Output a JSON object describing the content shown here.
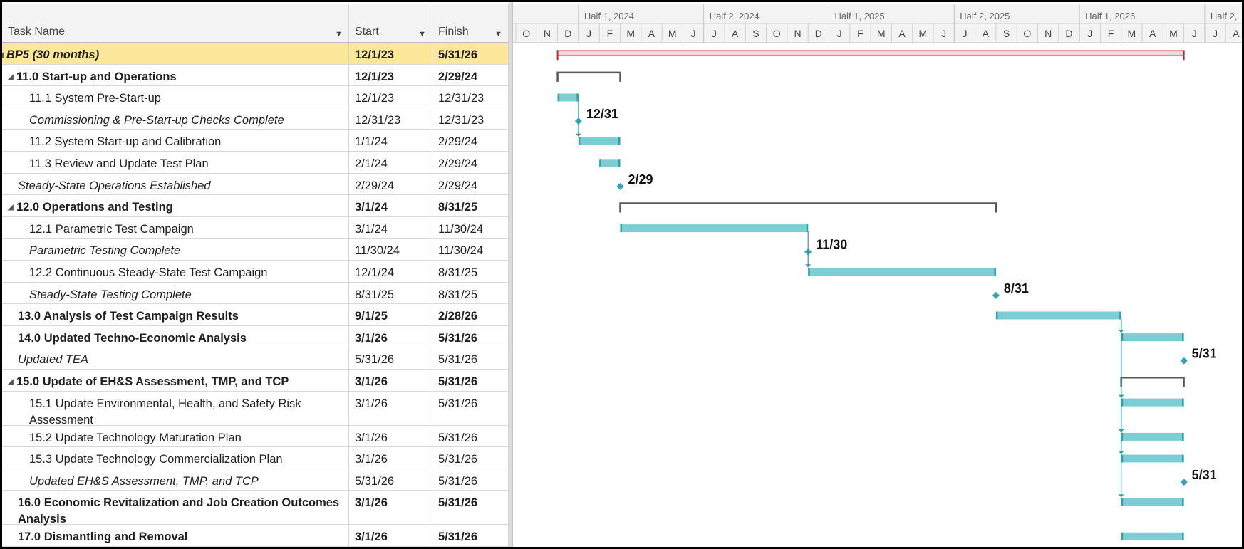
{
  "columns": {
    "name": "Task Name",
    "start": "Start",
    "finish": "Finish"
  },
  "timescale": {
    "halves": [
      "Half 1, 2024",
      "Half 2, 2024",
      "Half 1, 2025",
      "Half 2, 2025",
      "Half 1, 2026",
      "Half 2,"
    ],
    "months": [
      "O",
      "N",
      "D",
      "J",
      "F",
      "M",
      "A",
      "M",
      "J",
      "J",
      "A",
      "S",
      "O",
      "N",
      "D",
      "J",
      "F",
      "M",
      "A",
      "M",
      "J",
      "J",
      "A",
      "S",
      "O",
      "N",
      "D",
      "J",
      "F",
      "M",
      "A",
      "M",
      "J",
      "J",
      "A"
    ]
  },
  "colors": {
    "summary_fill": "#fde79a",
    "bar": "#7dcdd4",
    "bar_edge": "#2f9fa9",
    "milestone": "#35a3b0",
    "project_summary": "#c0282d",
    "bracket": "#595959"
  },
  "tasks": [
    {
      "name": "BP5 (30 months)",
      "start": "12/1/23",
      "finish": "5/31/26",
      "indent": 0,
      "bold": true,
      "italic": true,
      "collapsible": true,
      "kind": "project",
      "s": "2023-12-01",
      "f": "2026-05-31"
    },
    {
      "name": "11.0 Start-up and Operations",
      "start": "12/1/23",
      "finish": "2/29/24",
      "indent": 1,
      "bold": true,
      "collapsible": true,
      "kind": "summary",
      "s": "2023-12-01",
      "f": "2024-02-29"
    },
    {
      "name": "11.1 System Pre-Start-up",
      "start": "12/1/23",
      "finish": "12/31/23",
      "indent": 2,
      "kind": "task",
      "s": "2023-12-01",
      "f": "2023-12-31"
    },
    {
      "name": "Commissioning & Pre-Start-up Checks Complete",
      "start": "12/31/23",
      "finish": "12/31/23",
      "indent": 2,
      "italic": true,
      "kind": "milestone",
      "s": "2023-12-31",
      "label": "12/31"
    },
    {
      "name": "11.2 System Start-up and Calibration",
      "start": "1/1/24",
      "finish": "2/29/24",
      "indent": 2,
      "kind": "task",
      "s": "2024-01-01",
      "f": "2024-02-29"
    },
    {
      "name": "11.3 Review and Update Test Plan",
      "start": "2/1/24",
      "finish": "2/29/24",
      "indent": 2,
      "kind": "task",
      "s": "2024-02-01",
      "f": "2024-02-29"
    },
    {
      "name": "Steady-State Operations Established",
      "start": "2/29/24",
      "finish": "2/29/24",
      "indent": 1,
      "italic": true,
      "kind": "milestone",
      "s": "2024-02-29",
      "label": "2/29"
    },
    {
      "name": "12.0 Operations and Testing",
      "start": "3/1/24",
      "finish": "8/31/25",
      "indent": 1,
      "bold": true,
      "collapsible": true,
      "kind": "summary",
      "s": "2024-03-01",
      "f": "2025-08-31"
    },
    {
      "name": "12.1 Parametric Test Campaign",
      "start": "3/1/24",
      "finish": "11/30/24",
      "indent": 2,
      "kind": "task",
      "s": "2024-03-01",
      "f": "2024-11-30"
    },
    {
      "name": "Parametric Testing Complete",
      "start": "11/30/24",
      "finish": "11/30/24",
      "indent": 2,
      "italic": true,
      "kind": "milestone",
      "s": "2024-11-30",
      "label": "11/30"
    },
    {
      "name": "12.2 Continuous Steady-State Test Campaign",
      "start": "12/1/24",
      "finish": "8/31/25",
      "indent": 2,
      "kind": "task",
      "s": "2024-12-01",
      "f": "2025-08-31"
    },
    {
      "name": "Steady-State Testing Complete",
      "start": "8/31/25",
      "finish": "8/31/25",
      "indent": 2,
      "italic": true,
      "kind": "milestone",
      "s": "2025-08-31",
      "label": "8/31"
    },
    {
      "name": "13.0 Analysis of Test Campaign Results",
      "start": "9/1/25",
      "finish": "2/28/26",
      "indent": 1,
      "bold": true,
      "kind": "task",
      "s": "2025-09-01",
      "f": "2026-02-28"
    },
    {
      "name": "14.0 Updated Techno-Economic Analysis",
      "start": "3/1/26",
      "finish": "5/31/26",
      "indent": 1,
      "bold": true,
      "kind": "task",
      "s": "2026-03-01",
      "f": "2026-05-31"
    },
    {
      "name": "Updated TEA",
      "start": "5/31/26",
      "finish": "5/31/26",
      "indent": 1,
      "italic": true,
      "kind": "milestone",
      "s": "2026-05-31",
      "label": "5/31"
    },
    {
      "name": "15.0 Update of EH&S Assessment, TMP, and TCP",
      "start": "3/1/26",
      "finish": "5/31/26",
      "indent": 1,
      "bold": true,
      "collapsible": true,
      "kind": "summary",
      "s": "2026-03-01",
      "f": "2026-05-31"
    },
    {
      "name": "15.1 Update Environmental, Health, and Safety Risk Assessment",
      "start": "3/1/26",
      "finish": "5/31/26",
      "indent": 2,
      "kind": "task",
      "s": "2026-03-01",
      "f": "2026-05-31",
      "tall": true
    },
    {
      "name": "15.2 Update Technology Maturation Plan",
      "start": "3/1/26",
      "finish": "5/31/26",
      "indent": 2,
      "kind": "task",
      "s": "2026-03-01",
      "f": "2026-05-31"
    },
    {
      "name": "15.3 Update Technology Commercialization Plan",
      "start": "3/1/26",
      "finish": "5/31/26",
      "indent": 2,
      "kind": "task",
      "s": "2026-03-01",
      "f": "2026-05-31"
    },
    {
      "name": "Updated EH&S Assessment, TMP, and TCP",
      "start": "5/31/26",
      "finish": "5/31/26",
      "indent": 2,
      "italic": true,
      "kind": "milestone",
      "s": "2026-05-31",
      "label": "5/31"
    },
    {
      "name": "16.0 Economic Revitalization and Job Creation Outcomes Analysis",
      "start": "3/1/26",
      "finish": "5/31/26",
      "indent": 1,
      "bold": true,
      "kind": "task",
      "s": "2026-03-01",
      "f": "2026-05-31",
      "tall": true
    },
    {
      "name": "17.0 Dismantling and Removal",
      "start": "3/1/26",
      "finish": "5/31/26",
      "indent": 1,
      "bold": true,
      "kind": "task",
      "s": "2026-03-01",
      "f": "2026-05-31"
    }
  ]
}
